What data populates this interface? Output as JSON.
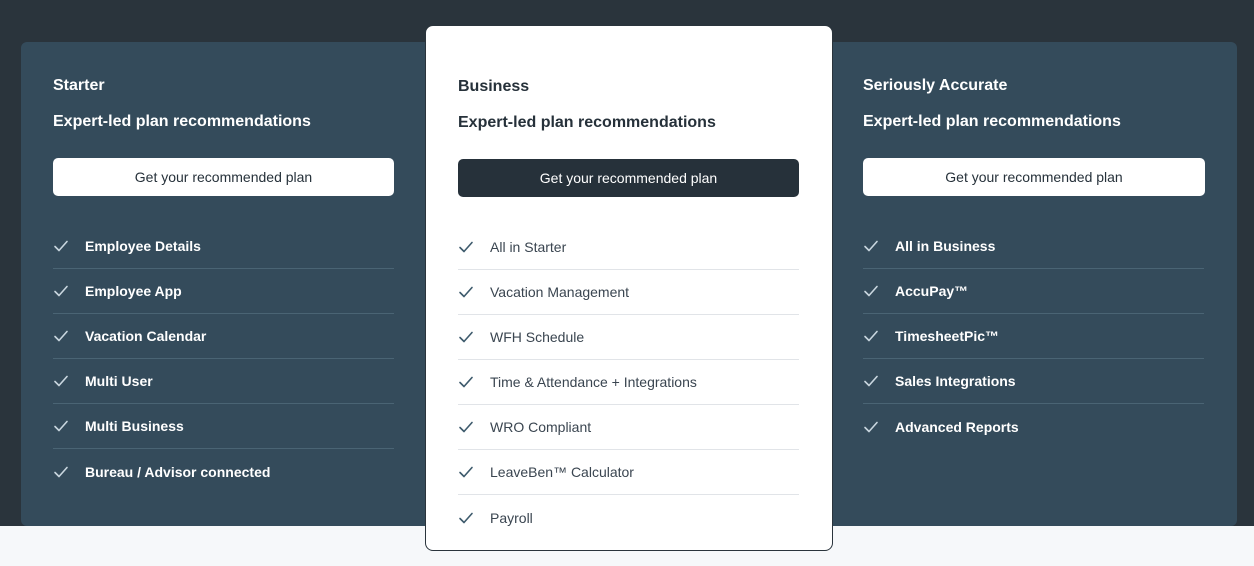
{
  "colors": {
    "page_background": "#2a343c",
    "panel_background": "#344b5b",
    "highlight_card": "#ffffff",
    "dark_button": "#26313a",
    "check_light": "#c9d6df",
    "check_dark": "#3d5a6c",
    "footer_band": "#f6f8fa"
  },
  "plans": [
    {
      "name": "Starter",
      "subtitle": "Expert-led plan recommendations",
      "cta_label": "Get your recommended plan",
      "features": [
        "Employee Details",
        "Employee App",
        "Vacation Calendar",
        "Multi User",
        "Multi Business",
        "Bureau / Advisor connected"
      ]
    },
    {
      "name": "Business",
      "subtitle": "Expert-led plan recommendations",
      "cta_label": "Get your recommended plan",
      "features": [
        "All in Starter",
        "Vacation Management",
        "WFH Schedule",
        "Time & Attendance + Integrations",
        "WRO Compliant",
        "LeaveBen™ Calculator",
        "Payroll"
      ]
    },
    {
      "name": "Seriously Accurate",
      "subtitle": "Expert-led plan recommendations",
      "cta_label": "Get your recommended plan",
      "features": [
        "All in Business",
        "AccuPay™",
        "TimesheetPic™",
        "Sales Integrations",
        "Advanced Reports"
      ]
    }
  ],
  "icons": {
    "feature_check": "check-icon"
  }
}
